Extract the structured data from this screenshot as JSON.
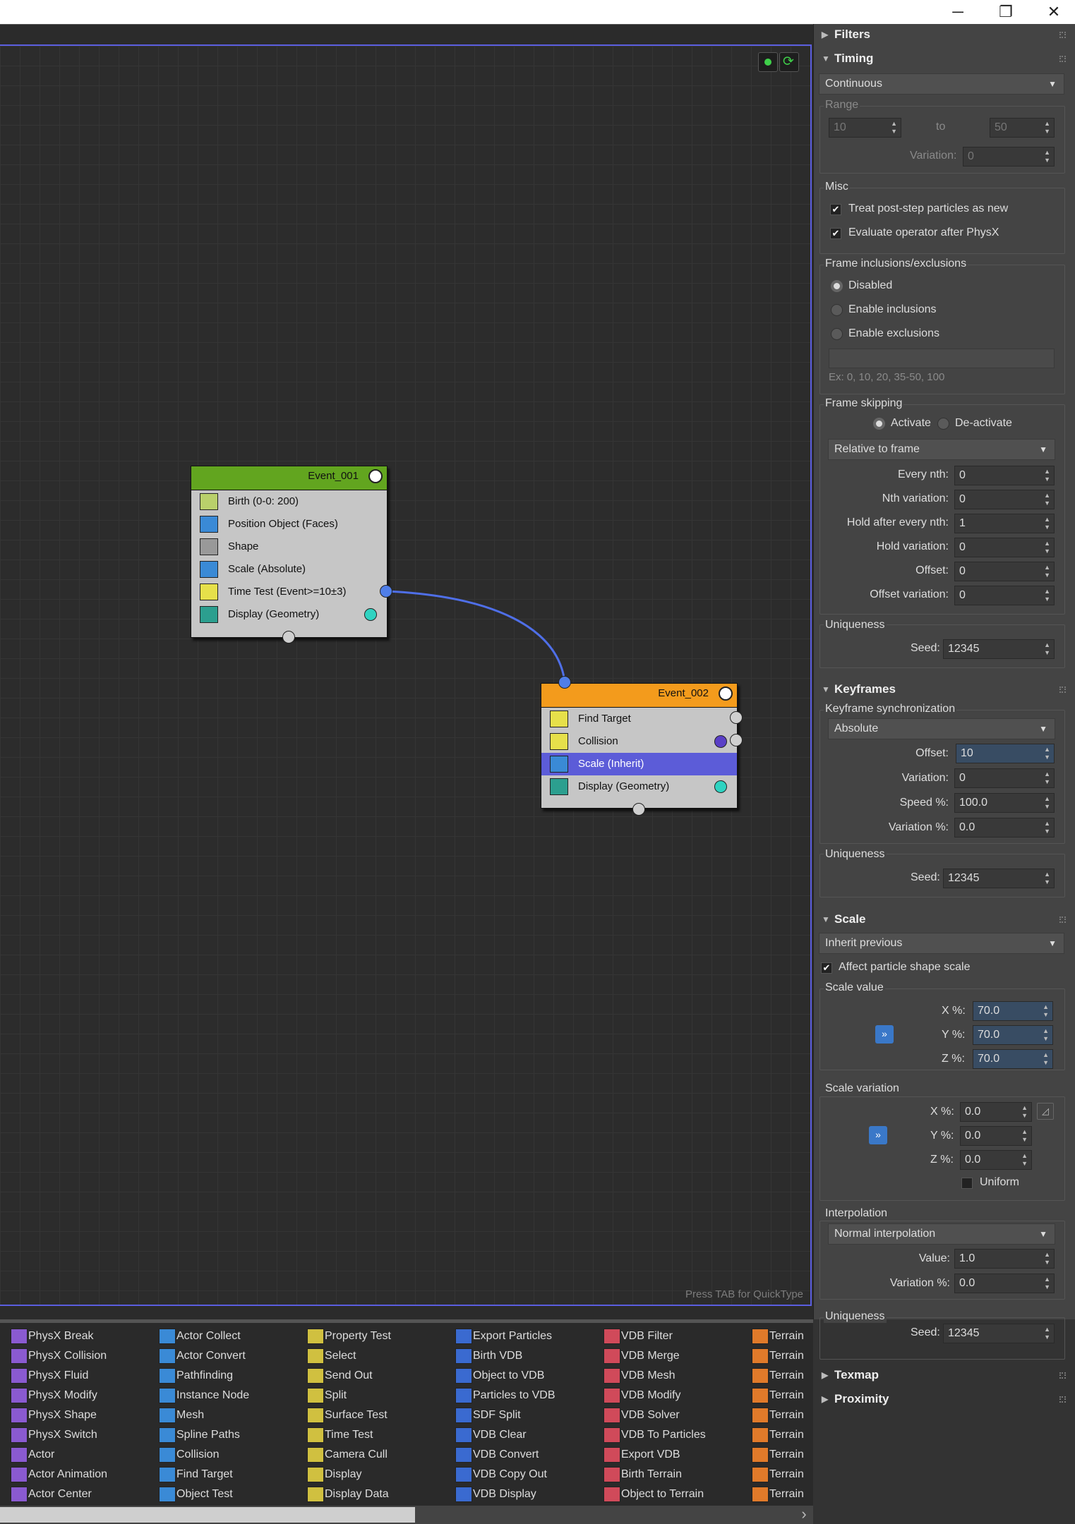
{
  "window": {
    "minimize": "─",
    "restore": "❐",
    "close": "✕"
  },
  "canvas": {
    "hint": "Press TAB for QuickType"
  },
  "event1": {
    "title": "Event_001",
    "rows": [
      "Birth (0-0: 200)",
      "Position Object (Faces)",
      "Shape",
      "Scale (Absolute)",
      "Time Test (Event>=10±3)",
      "Display (Geometry)"
    ]
  },
  "event2": {
    "title": "Event_002",
    "rows": [
      "Find Target",
      "Collision",
      "Scale (Inherit)",
      "Display (Geometry)"
    ]
  },
  "panel": {
    "filters": "Filters",
    "timing": {
      "title": "Timing",
      "mode": "Continuous",
      "range_label": "Range",
      "from": "10",
      "to_label": "to",
      "to": "50",
      "variation_label": "Variation:",
      "variation": "0",
      "misc_label": "Misc",
      "treat": "Treat post-step particles as new",
      "evaluate": "Evaluate operator after PhysX",
      "frame_incl_label": "Frame inclusions/exclusions",
      "disabled": "Disabled",
      "enable_incl": "Enable inclusions",
      "enable_excl": "Enable exclusions",
      "incl_placeholder": "Ex: 0, 10, 20, 35-50, 100",
      "frame_skip_label": "Frame skipping",
      "activate": "Activate",
      "deactivate": "De-activate",
      "relative": "Relative to frame",
      "every_nth_label": "Every nth:",
      "every_nth": "0",
      "nth_var_label": "Nth variation:",
      "nth_var": "0",
      "hold_label": "Hold after every nth:",
      "hold": "1",
      "hold_var_label": "Hold variation:",
      "hold_var": "0",
      "offset_label": "Offset:",
      "offset": "0",
      "offset_var_label": "Offset variation:",
      "offset_var": "0",
      "uniq_label": "Uniqueness",
      "seed_label": "Seed:",
      "seed": "12345"
    },
    "keyframes": {
      "title": "Keyframes",
      "sync_label": "Keyframe synchronization",
      "sync": "Absolute",
      "offset_label": "Offset:",
      "offset": "10",
      "var_label": "Variation:",
      "var": "0",
      "speed_label": "Speed %:",
      "speed": "100.0",
      "var_pct_label": "Variation %:",
      "var_pct": "0.0",
      "uniq_label": "Uniqueness",
      "seed_label": "Seed:",
      "seed": "12345"
    },
    "scale": {
      "title": "Scale",
      "mode": "Inherit previous",
      "affect": "Affect particle shape scale",
      "value_label": "Scale value",
      "x_label": "X %:",
      "x": "70.0",
      "y_label": "Y %:",
      "y": "70.0",
      "z_label": "Z %:",
      "z": "70.0",
      "var_label": "Scale variation",
      "vx": "0.0",
      "vy": "0.0",
      "vz": "0.0",
      "uniform": "Uniform",
      "interp_label": "Interpolation",
      "interp": "Normal interpolation",
      "value_lbl": "Value:",
      "value": "1.0",
      "var_pct_label": "Variation %:",
      "var_pct": "0.0",
      "uniq_label": "Uniqueness",
      "seed_label": "Seed:",
      "seed": "12345",
      "link": "»"
    },
    "texmap": "Texmap",
    "proximity": "Proximity"
  },
  "library": {
    "cols": [
      [
        "PhysX Break",
        "PhysX Collision",
        "PhysX Fluid",
        "PhysX Modify",
        "PhysX Shape",
        "PhysX Switch",
        "Actor",
        "Actor Animation",
        "Actor Center"
      ],
      [
        "Actor Collect",
        "Actor Convert",
        "Pathfinding",
        "Instance Node",
        "Mesh",
        "Spline Paths",
        "Collision",
        "Find Target",
        "Object Test"
      ],
      [
        "Property Test",
        "Select",
        "Send Out",
        "Split",
        "Surface Test",
        "Time Test",
        "Camera Cull",
        "Display",
        "Display Data"
      ],
      [
        "Export Particles",
        "Birth VDB",
        "Object to VDB",
        "Particles to VDB",
        "SDF Split",
        "VDB Clear",
        "VDB Convert",
        "VDB Copy Out",
        "VDB Display"
      ],
      [
        "VDB Filter",
        "VDB Merge",
        "VDB Mesh",
        "VDB Modify",
        "VDB Solver",
        "VDB To Particles",
        "Export VDB",
        "Birth Terrain",
        "Object to Terrain"
      ],
      [
        "Terrain",
        "Terrain",
        "Terrain",
        "Terrain",
        "Terrain",
        "Terrain",
        "Terrain",
        "Terrain",
        "Terrain"
      ]
    ],
    "scroll_right": "›"
  }
}
